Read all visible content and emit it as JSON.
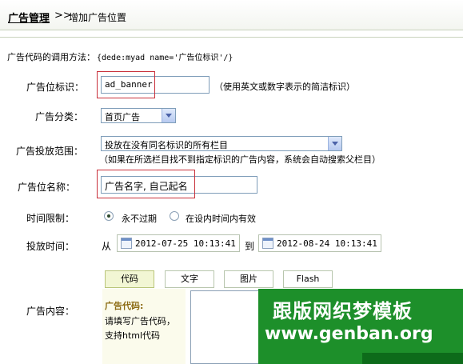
{
  "header": {
    "title": "广告管理",
    "separator": ">>",
    "crumb": "增加广告位置"
  },
  "usage": {
    "label": "广告代码的调用方法：",
    "code": "{dede:myad name='广告位标识'/}"
  },
  "form": {
    "tag": {
      "label": "广告位标识：",
      "value": "ad_banner",
      "hint": "（使用英文或数字表示的简洁标识）"
    },
    "category": {
      "label": "广告分类：",
      "value": "首页广告"
    },
    "scope": {
      "label": "广告投放范围：",
      "value": "投放在没有同名标识的所有栏目",
      "hint": "（如果在所选栏目找不到指定标识的广告内容，系统会自动搜索父栏目）"
    },
    "name": {
      "label": "广告位名称：",
      "value": "广告名字, 自己起名"
    },
    "time_limit": {
      "label": "时间限制：",
      "option_forever": "永不过期",
      "option_range": "在设内时间内有效",
      "selected": "永不过期"
    },
    "schedule": {
      "label": "投放时间：",
      "from_label": "从",
      "from_value": "2012-07-25 10:13:41",
      "to_label": "到",
      "to_value": "2012-08-24 10:13:41"
    },
    "content": {
      "label": "广告内容：",
      "tabs": [
        "代码",
        "文字",
        "图片",
        "Flash"
      ],
      "active_tab": "代码",
      "panel_heading": "广告代码:",
      "panel_line1": "请填写广告代码，",
      "panel_line2": "支持html代码"
    }
  },
  "watermark": {
    "line1": "跟版网织梦模板",
    "line2": "www.genban.org"
  },
  "colors": {
    "highlight_border": "#c8303a",
    "active_tab_bg": "#f2f6d4",
    "watermark_bg": "#1d8f2a"
  }
}
